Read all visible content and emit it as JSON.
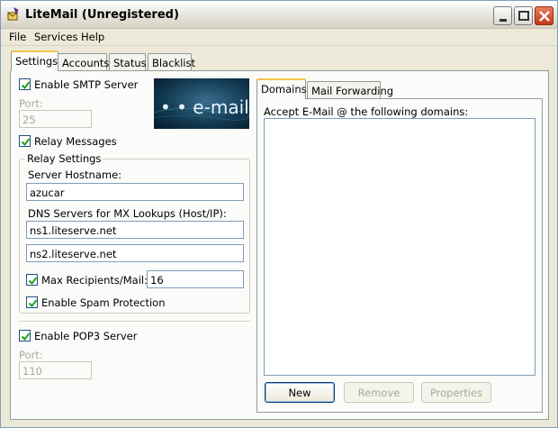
{
  "window": {
    "title": "LiteMail (Unregistered)"
  },
  "menu": [
    {
      "label": "File"
    },
    {
      "label": "Services"
    },
    {
      "label": "Help"
    }
  ],
  "tabs": [
    {
      "label": "Settings",
      "active": true
    },
    {
      "label": "Accounts",
      "active": false
    },
    {
      "label": "Status",
      "active": false
    },
    {
      "label": "Blacklist",
      "active": false
    }
  ],
  "smtp": {
    "enable_label": "Enable SMTP Server",
    "enabled": true,
    "port_label": "Port:",
    "port_value": "25",
    "relay_label": "Relay Messages",
    "relay_enabled": true
  },
  "banner": {
    "text": "• • e-mail"
  },
  "relay": {
    "group_title": "Relay Settings",
    "hostname_label": "Server Hostname:",
    "hostname_value": "azucar",
    "dns_label": "DNS Servers for MX Lookups (Host/IP):",
    "dns_servers": [
      "ns1.liteserve.net",
      "ns2.liteserve.net"
    ],
    "max_recipients_label": "Max Recipients/Mail:",
    "max_recipients_enabled": true,
    "max_recipients_value": "16",
    "spam_label": "Enable Spam Protection",
    "spam_enabled": true
  },
  "pop3": {
    "enable_label": "Enable POP3 Server",
    "enabled": true,
    "port_label": "Port:",
    "port_value": "110"
  },
  "domains_tabs": [
    {
      "label": "Domains",
      "active": true
    },
    {
      "label": "Mail Forwarding",
      "active": false
    }
  ],
  "domains": {
    "list_label": "Accept E-Mail @ the following domains:",
    "items": [],
    "buttons": {
      "new_label": "New",
      "remove_label": "Remove",
      "properties_label": "Properties"
    }
  },
  "colors": {
    "window_bg": "#ece9d8",
    "panel_bg": "#fbfbf9",
    "active_tab_accent": "#f7c34a",
    "field_border": "#7f9db9",
    "disabled_text": "#a8a79c",
    "checkbox_check": "#21a121",
    "close_button": "#c4391b"
  },
  "icons": {
    "app": "envelope-rocket-icon",
    "minimize": "minimize-icon",
    "maximize": "maximize-icon",
    "close": "close-icon",
    "check": "checkmark-icon"
  }
}
